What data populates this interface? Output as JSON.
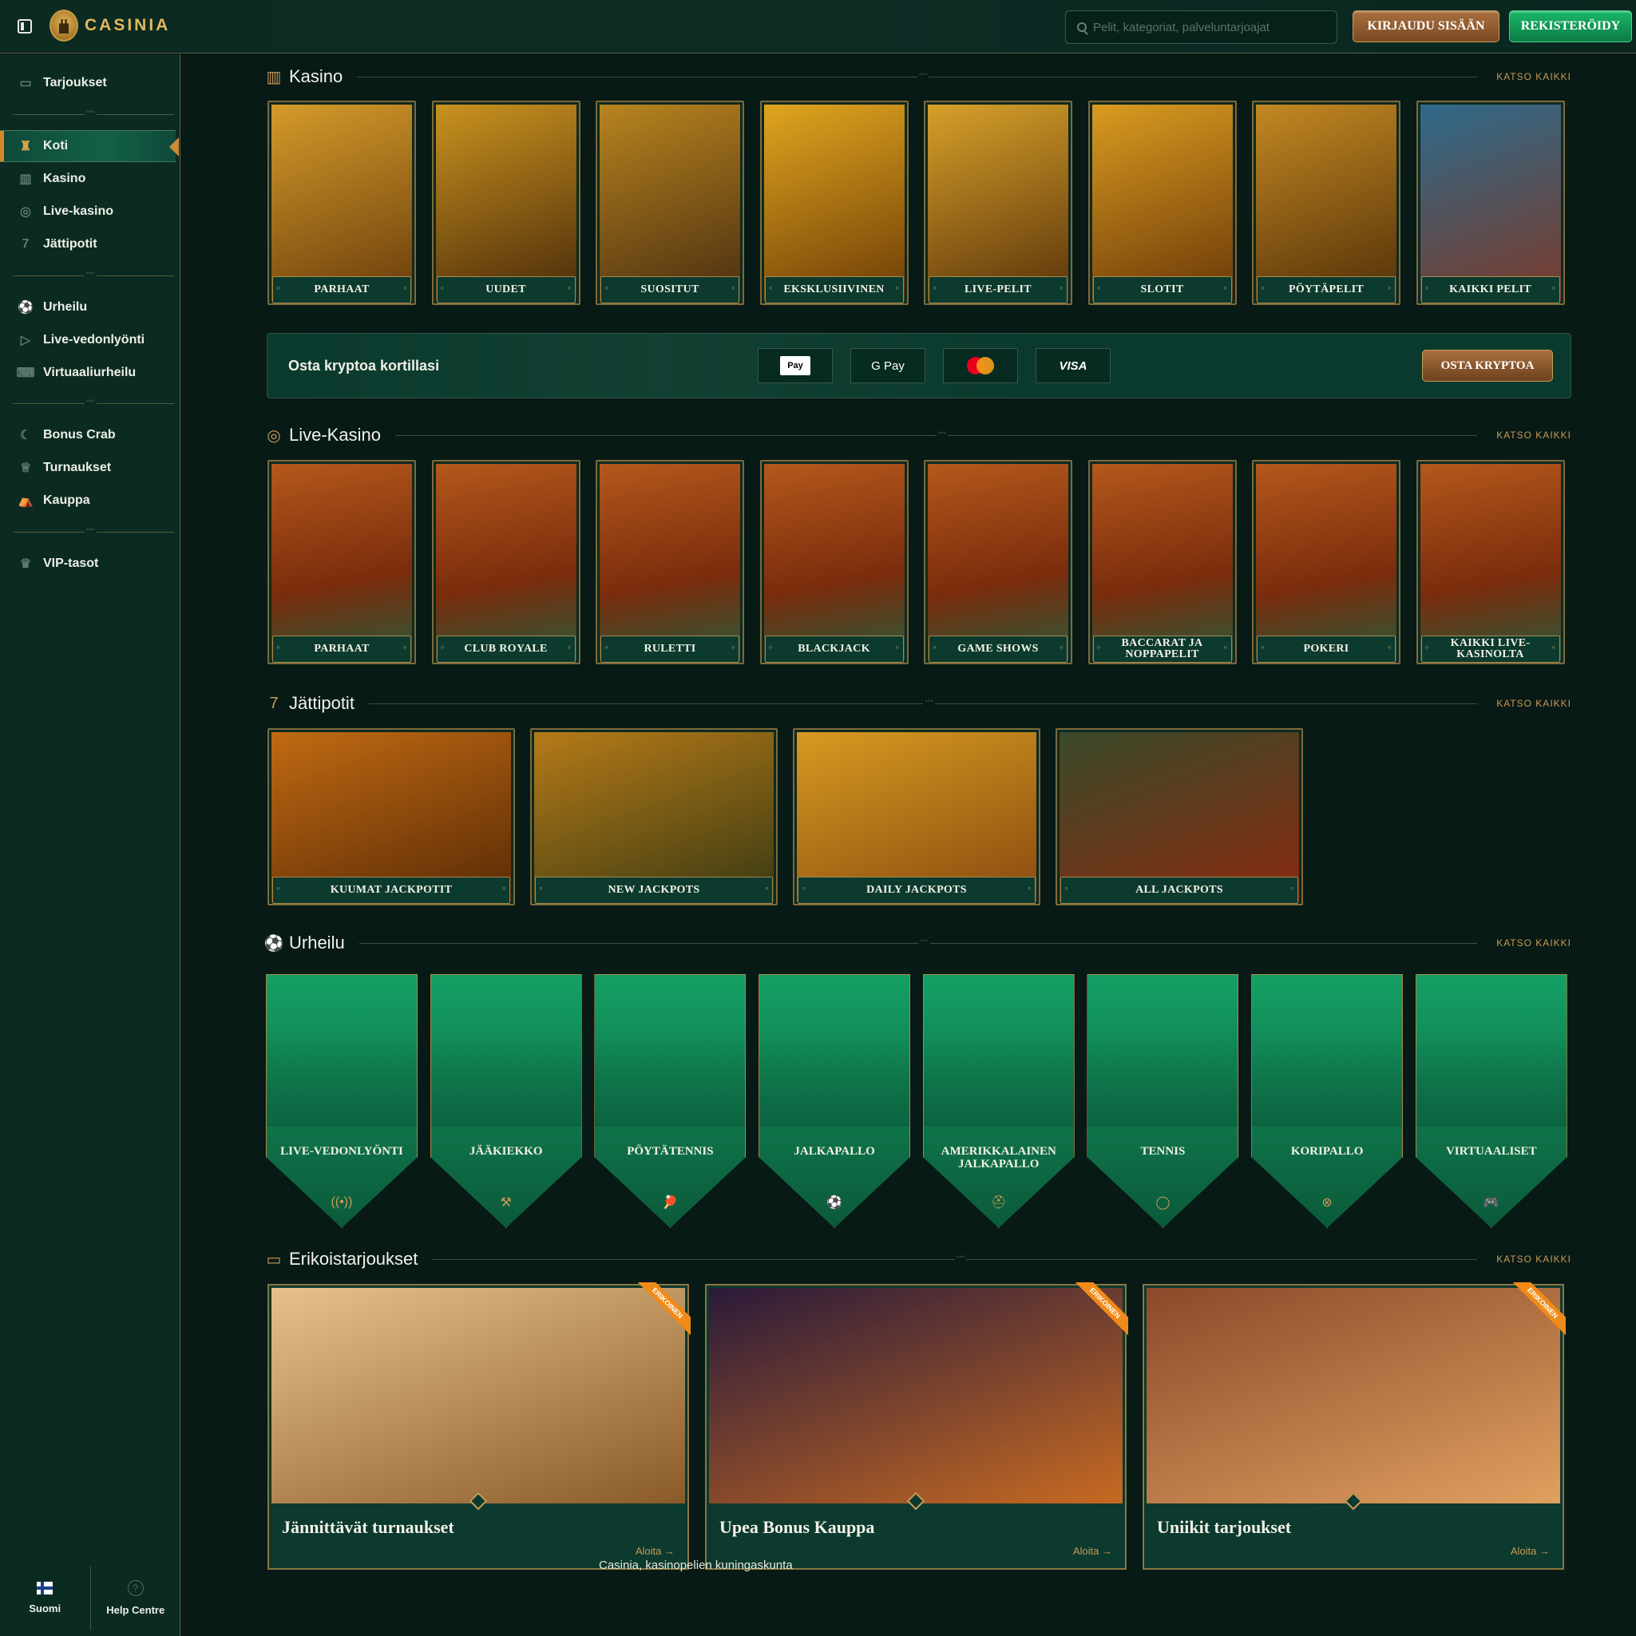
{
  "header": {
    "brand": "CASINIA",
    "search_placeholder": "Pelit, kategoriat, palveluntarjoajat",
    "login_label": "KIRJAUDU SISÄÄN",
    "register_label": "REKISTERÖIDY"
  },
  "sidebar": {
    "groups": [
      [
        {
          "label": "Tarjoukset",
          "icon": "chest-icon"
        }
      ],
      [
        {
          "label": "Koti",
          "icon": "castle-icon",
          "active": true
        },
        {
          "label": "Kasino",
          "icon": "slot-machine-icon"
        },
        {
          "label": "Live-kasino",
          "icon": "chip-icon"
        },
        {
          "label": "Jättipotit",
          "icon": "seven-icon"
        }
      ],
      [
        {
          "label": "Urheilu",
          "icon": "soccer-ball-icon"
        },
        {
          "label": "Live-vedonlyönti",
          "icon": "live-banner-icon"
        },
        {
          "label": "Virtuaaliurheilu",
          "icon": "gamepad-icon"
        }
      ],
      [
        {
          "label": "Bonus Crab",
          "icon": "crab-claw-icon"
        },
        {
          "label": "Turnaukset",
          "icon": "trophy-icon"
        },
        {
          "label": "Kauppa",
          "icon": "shop-tent-icon"
        }
      ],
      [
        {
          "label": "VIP-tasot",
          "icon": "crown-icon"
        }
      ]
    ],
    "footer": {
      "language": "Suomi",
      "help": "Help Centre"
    }
  },
  "sections": {
    "casino": {
      "title": "Kasino",
      "more": "KATSO KAIKKI",
      "cards": [
        "PARHAAT",
        "UUDET",
        "SUOSITUT",
        "EKSKLUSIIVINEN",
        "LIVE-PELIT",
        "SLOTIT",
        "PÖYTÄPELIT",
        "KAIKKI PELIT"
      ]
    },
    "crypto": {
      "text": "Osta kryptoa kortillasi",
      "methods": [
        "Apple Pay",
        "G Pay",
        "Mastercard",
        "VISA"
      ],
      "apple_label": "Pay",
      "gpay_label": "G Pay",
      "visa_label": "VISA",
      "button": "OSTA KRYPTOA"
    },
    "live": {
      "title": "Live-Kasino",
      "more": "KATSO KAIKKI",
      "cards": [
        "PARHAAT",
        "CLUB ROYALE",
        "RULETTI",
        "BLACKJACK",
        "GAME SHOWS",
        "BACCARAT JA NOPPAPELIT",
        "POKERI",
        "KAIKKI LIVE-KASINOLTA"
      ]
    },
    "jackpots": {
      "title": "Jättipotit",
      "more": "KATSO KAIKKI",
      "cards": [
        "KUUMAT JACKPOTIT",
        "NEW JACKPOTS",
        "DAILY JACKPOTS",
        "ALL JACKPOTS"
      ]
    },
    "sports": {
      "title": "Urheilu",
      "more": "KATSO KAIKKI",
      "cards": [
        {
          "label": "LIVE-VEDONLYÖNTI",
          "icon": "broadcast-icon"
        },
        {
          "label": "JÄÄKIEKKO",
          "icon": "hockey-sticks-icon"
        },
        {
          "label": "PÖYTÄTENNIS",
          "icon": "ping-pong-icon"
        },
        {
          "label": "JALKAPALLO",
          "icon": "soccer-ball-icon"
        },
        {
          "label": "AMERIKKALAINEN JALKAPALLO",
          "icon": "football-helmet-icon"
        },
        {
          "label": "TENNIS",
          "icon": "tennis-ball-icon"
        },
        {
          "label": "KORIPALLO",
          "icon": "basketball-icon"
        },
        {
          "label": "VIRTUAALISET",
          "icon": "gamepad-icon"
        }
      ]
    },
    "offers": {
      "title": "Erikoistarjoukset",
      "more": "KATSO KAIKKI",
      "ribbon": "ERIKOINEN",
      "cards": [
        {
          "title": "Jännittävät turnaukset",
          "cta": "Aloita →"
        },
        {
          "title": "Upea Bonus Kauppa",
          "cta": "Aloita →"
        },
        {
          "title": "Uniikit tarjoukset",
          "cta": "Aloita →"
        }
      ]
    }
  },
  "footer": {
    "tagline": "Casinia, kasinopelien kuningaskunta"
  },
  "colors": {
    "background": "#071a15",
    "panel": "#0b2a22",
    "gold": "#c99a58",
    "login": "#8a5a2e",
    "register": "#12a15b",
    "ribbon": "#f08a18"
  }
}
